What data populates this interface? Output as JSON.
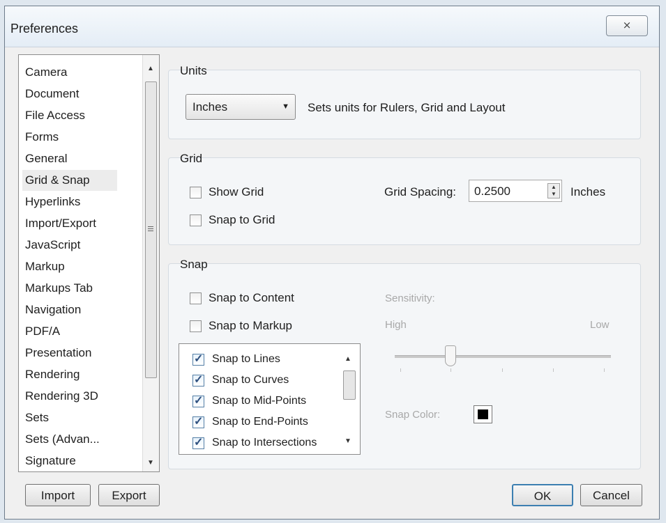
{
  "window": {
    "title": "Preferences",
    "close_glyph": "⨯"
  },
  "categories": {
    "items": [
      "Camera",
      "Document",
      "File Access",
      "Forms",
      "General",
      "Grid & Snap",
      "Hyperlinks",
      "Import/Export",
      "JavaScript",
      "Markup",
      "Markups Tab",
      "Navigation",
      "PDF/A",
      "Presentation",
      "Rendering",
      "Rendering 3D",
      "Sets",
      "Sets (Advan...",
      "Signature"
    ],
    "selected": "Grid & Snap"
  },
  "footer": {
    "import_label": "Import",
    "export_label": "Export",
    "ok_label": "OK",
    "cancel_label": "Cancel"
  },
  "units": {
    "group_label": "Units",
    "selected": "Inches",
    "description": "Sets units for Rulers, Grid and Layout"
  },
  "grid": {
    "group_label": "Grid",
    "show_grid_label": "Show Grid",
    "show_grid_checked": false,
    "snap_to_grid_label": "Snap to Grid",
    "snap_to_grid_checked": false,
    "spacing_label": "Grid Spacing:",
    "spacing_value": "0.2500",
    "spacing_unit": "Inches"
  },
  "snap": {
    "group_label": "Snap",
    "snap_content_label": "Snap to Content",
    "snap_content_checked": false,
    "snap_markup_label": "Snap to Markup",
    "snap_markup_checked": false,
    "options": [
      {
        "label": "Snap to Lines",
        "checked": true
      },
      {
        "label": "Snap to Curves",
        "checked": true
      },
      {
        "label": "Snap to Mid-Points",
        "checked": true
      },
      {
        "label": "Snap to End-Points",
        "checked": true
      },
      {
        "label": "Snap to Intersections",
        "checked": true
      }
    ],
    "sensitivity_label": "Sensitivity:",
    "high_label": "High",
    "low_label": "Low",
    "sensitivity_level": 0.25,
    "snap_color_label": "Snap Color:",
    "snap_color": "#000000"
  },
  "colors": {
    "accent_border": "#3c7fb1"
  }
}
